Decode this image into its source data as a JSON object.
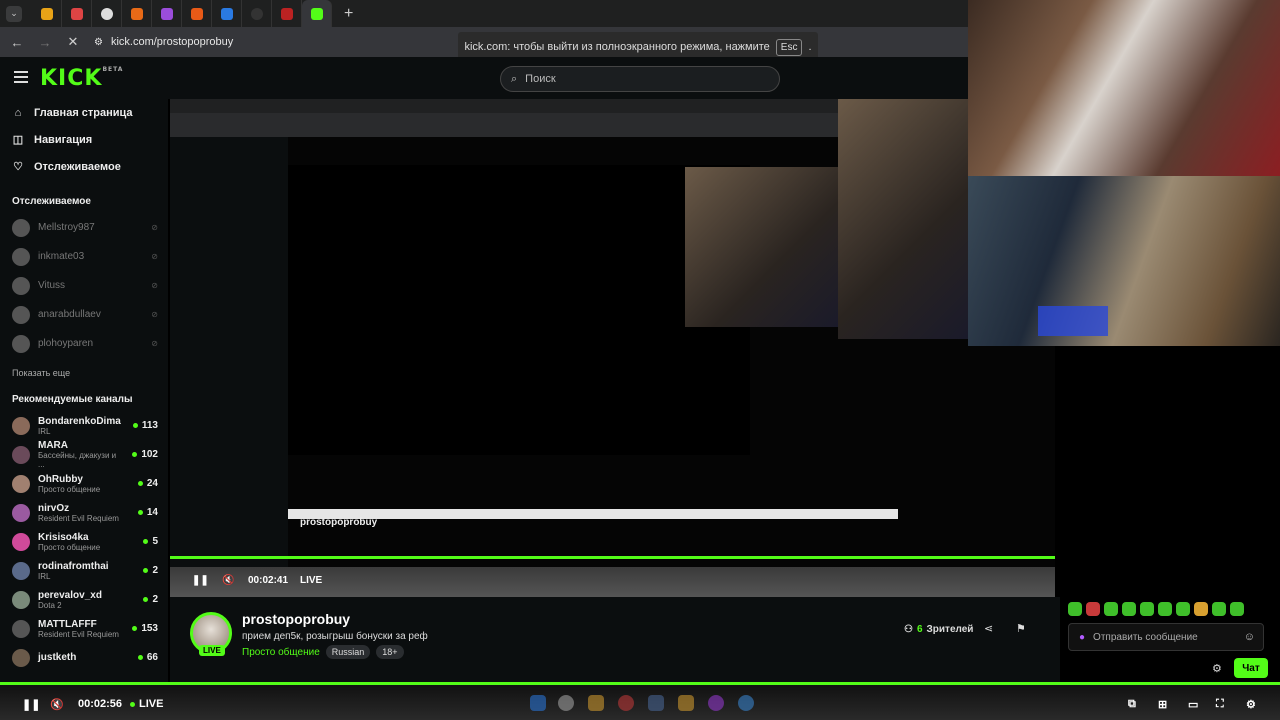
{
  "browser": {
    "url": "kick.com/prostopoprobuy",
    "fullscreen_notice": {
      "text": "kick.com: чтобы выйти из полноэкранного режима, нажмите",
      "key": "Esc",
      "suffix": "."
    }
  },
  "kick": {
    "logo": "KICK",
    "logo_suffix": "BETA",
    "search_placeholder": "Поиск",
    "nav": [
      {
        "label": "Главная страница",
        "icon": "home-icon"
      },
      {
        "label": "Навигация",
        "icon": "compass-icon"
      },
      {
        "label": "Отслеживаемое",
        "icon": "heart-icon"
      }
    ],
    "following_title": "Отслеживаемое",
    "following": [
      "Mellstroy987",
      "inkmate03",
      "Vituss",
      "anarabdullaev",
      "plohoyparen"
    ],
    "show_more": "Показать еще",
    "recommended_title": "Рекомендуемые каналы",
    "recommended": [
      {
        "name": "BondarenkoDima",
        "category": "IRL",
        "viewers": "113"
      },
      {
        "name": "MARA",
        "category": "Бассейны, джакузи и ...",
        "viewers": "102"
      },
      {
        "name": "OhRubby",
        "category": "Просто общение",
        "viewers": "24"
      },
      {
        "name": "nirvOz",
        "category": "Resident Evil Requiem",
        "viewers": "14"
      },
      {
        "name": "Krisiso4ka",
        "category": "Просто общение",
        "viewers": "5"
      },
      {
        "name": "rodinafromthai",
        "category": "IRL",
        "viewers": "2"
      },
      {
        "name": "perevalov_xd",
        "category": "Dota 2",
        "viewers": "2"
      },
      {
        "name": "MATTLAFFF",
        "category": "Resident Evil Requiem",
        "viewers": "153"
      },
      {
        "name": "justketh",
        "category": "",
        "viewers": "66"
      }
    ]
  },
  "channel": {
    "name": "prostopoprobuy",
    "title": "прием деп5к, розыгрыш бонуски за реф",
    "category": "Просто общение",
    "tags": [
      "Russian",
      "18+"
    ],
    "live": "LIVE",
    "viewers": "6",
    "viewers_label": "Зрителей"
  },
  "inner_player": {
    "time": "00:02:41",
    "live": "LIVE"
  },
  "outer_player": {
    "time": "00:02:56",
    "live": "LIVE"
  },
  "chat": {
    "placeholder": "Отправить сообщение",
    "button": "Чат"
  },
  "colors": {
    "accent": "#53fc18",
    "bg": "#0b0e0f"
  }
}
